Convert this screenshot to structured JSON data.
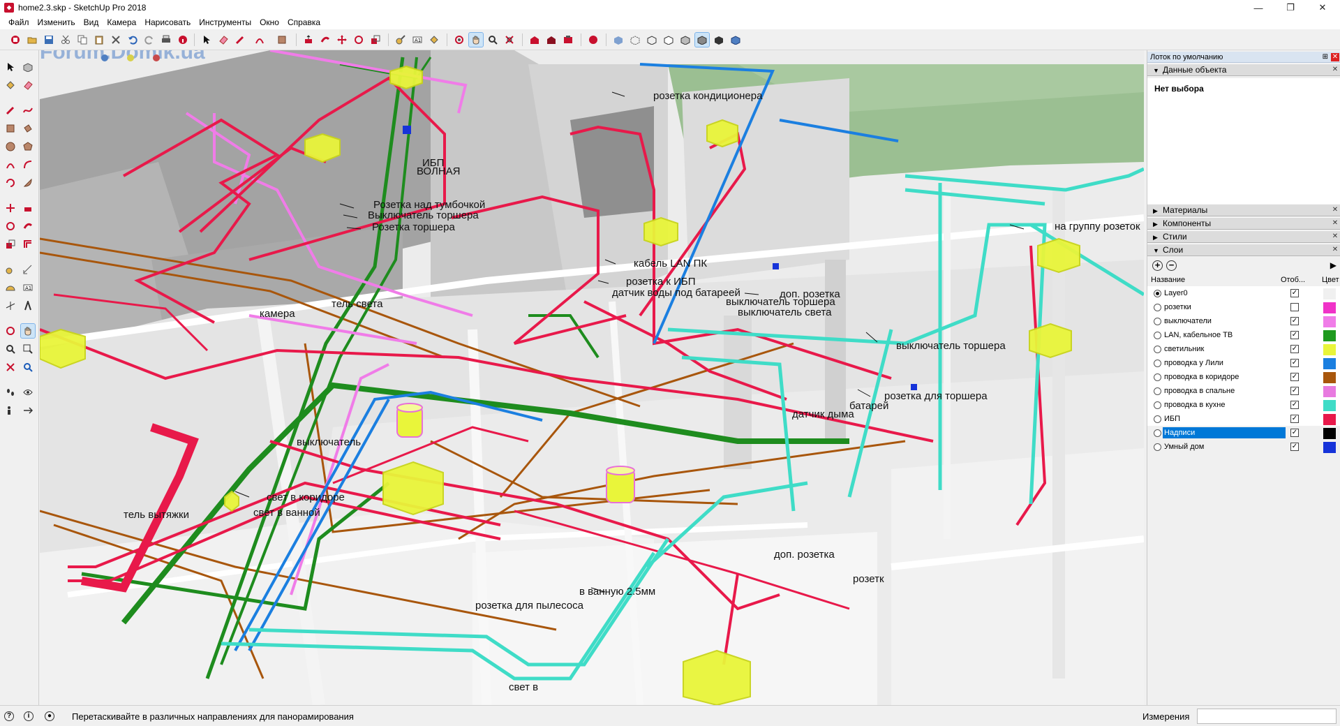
{
  "window": {
    "title": "home2.3.skp - SketchUp Pro 2018",
    "minimize": "—",
    "restore": "❐",
    "close": "✕"
  },
  "menu": [
    {
      "label": "Файл"
    },
    {
      "label": "Изменить"
    },
    {
      "label": "Вид"
    },
    {
      "label": "Камера"
    },
    {
      "label": "Нарисовать"
    },
    {
      "label": "Инструменты"
    },
    {
      "label": "Окно"
    },
    {
      "label": "Справка"
    }
  ],
  "watermark": "Forum.Domik.ua",
  "viewport": {
    "labels": [
      {
        "text": "розетка кондиционера"
      },
      {
        "text": "ИБП"
      },
      {
        "text": "ВОЛНАЯ"
      },
      {
        "text": "Розетка над тумбочкой"
      },
      {
        "text": "Выключатель торшера"
      },
      {
        "text": "Розетка торшера"
      },
      {
        "text": "на группу розеток"
      },
      {
        "text": "кабель LAN ПК"
      },
      {
        "text": "розетка к ИБП"
      },
      {
        "text": "датчик воды под батареей"
      },
      {
        "text": "доп. розетка"
      },
      {
        "text": "выключатель торшера"
      },
      {
        "text": "выключатель света"
      },
      {
        "text": "выключатель торшера"
      },
      {
        "text": "розетка для торшера"
      },
      {
        "text": "батарей"
      },
      {
        "text": "датчик дыма"
      },
      {
        "text": "выключатель"
      },
      {
        "text": "свет в коридоре"
      },
      {
        "text": "свет в ванной"
      },
      {
        "text": "тель вытяжки"
      },
      {
        "text": "доп. розетка"
      },
      {
        "text": "розетк"
      },
      {
        "text": "в ванную 2.5мм"
      },
      {
        "text": "розетка для пылесоса"
      },
      {
        "text": "свет в"
      },
      {
        "text": "тель света"
      },
      {
        "text": "камера"
      }
    ]
  },
  "tray": {
    "title": "Лоток по умолчанию",
    "pin": "⊞",
    "close": "✕",
    "entity_info": {
      "header": "Данные объекта",
      "no_selection": "Нет выбора"
    },
    "sections": [
      {
        "label": "Материалы"
      },
      {
        "label": "Компоненты"
      },
      {
        "label": "Стили"
      }
    ],
    "layers_header": "Слои",
    "layers_columns": {
      "name": "Название",
      "visible": "Отоб...",
      "color": "Цвет"
    },
    "add_layer": "+",
    "remove_layer": "−",
    "details": "▶",
    "layers": [
      {
        "name": "Layer0",
        "active": true,
        "visible": true,
        "color": "#f0f0f0",
        "selected": false
      },
      {
        "name": "розетки",
        "active": false,
        "visible": false,
        "color": "#f033c8",
        "selected": false
      },
      {
        "name": "выключатели",
        "active": false,
        "visible": true,
        "color": "#f07ce8",
        "selected": false
      },
      {
        "name": "LAN, кабельное ТВ",
        "active": false,
        "visible": true,
        "color": "#1e9a1e",
        "selected": false
      },
      {
        "name": "светильник",
        "active": false,
        "visible": true,
        "color": "#e9f53a",
        "selected": false
      },
      {
        "name": "проводка у Лили",
        "active": false,
        "visible": true,
        "color": "#1b7fe0",
        "selected": false
      },
      {
        "name": "проводка в коридоре",
        "active": false,
        "visible": true,
        "color": "#a8560c",
        "selected": false
      },
      {
        "name": "проводка в спальне",
        "active": false,
        "visible": true,
        "color": "#e87ae0",
        "selected": false
      },
      {
        "name": "проводка в кухне",
        "active": false,
        "visible": true,
        "color": "#3fdcc7",
        "selected": false
      },
      {
        "name": "ИБП",
        "active": false,
        "visible": true,
        "color": "#e8194a",
        "selected": false
      },
      {
        "name": "Надписи",
        "active": false,
        "visible": true,
        "color": "#000000",
        "selected": true
      },
      {
        "name": "Умный дом",
        "active": false,
        "visible": true,
        "color": "#1633d9",
        "selected": false
      }
    ]
  },
  "status": {
    "text": "Перетаскивайте в различных направлениях для панорамирования",
    "measurements_label": "Измерения",
    "measurements_value": ""
  },
  "colors": {
    "pink_wire": "#e8194a",
    "green_wire": "#1e8c1e",
    "blue_wire": "#1b7fe0",
    "brown_wire": "#a8560c",
    "cyan_wire": "#3fdcc7",
    "magenta_wire": "#f07ce8",
    "lamp": "#e9f53a",
    "wall_dark": "#9c9c9c",
    "wall_light": "#e6e6e6",
    "grass": "#9bbf92"
  }
}
